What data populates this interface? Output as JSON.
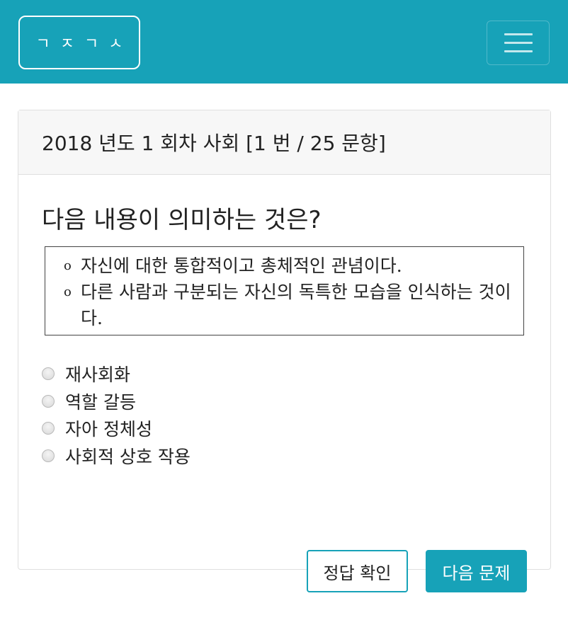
{
  "navbar": {
    "brand": "ㄱㅈㄱㅅ",
    "toggler_icon": "hamburger-menu-icon"
  },
  "card": {
    "header": "2018 년도 1 회차 사회 [1 번 / 25 문항]",
    "question": "다음 내용이 의미하는 것은?",
    "passage": [
      "자신에 대한 통합적이고 총체적인 관념이다.",
      "다른 사람과 구분되는 자신의 독특한 모습을 인식하는 것이다."
    ],
    "bullet": "o",
    "options": [
      "재사회화",
      "역할 갈등",
      "자아 정체성",
      "사회적 상호 작용"
    ],
    "buttons": {
      "check": "정답 확인",
      "next": "다음 문제"
    }
  },
  "colors": {
    "accent": "#17a2b8"
  }
}
